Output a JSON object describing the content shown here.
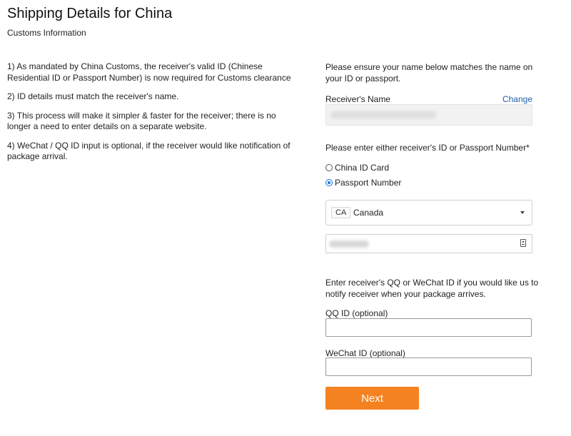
{
  "header": {
    "title": "Shipping Details for China",
    "subtitle": "Customs Information"
  },
  "info": {
    "items": [
      "1) As mandated by China Customs, the receiver's valid ID (Chinese Residential ID or Passport Number) is now required for Customs clearance",
      "2) ID details must match the receiver's name.",
      "3) This process will make it simpler & faster for the receiver; there is no longer a need to enter details on a separate website.",
      "4) WeChat / QQ ID input is optional, if the receiver would like notification of package arrival."
    ]
  },
  "form": {
    "name_note": "Please ensure your name below matches the name on your ID or passport.",
    "name_label": "Receiver's Name",
    "change_label": "Change",
    "id_prompt": "Please enter either receiver's ID or Passport Number*",
    "id_options": [
      {
        "label": "China ID Card",
        "checked": false
      },
      {
        "label": "Passport Number",
        "checked": true
      }
    ],
    "country": {
      "code": "CA",
      "name": "Canada"
    },
    "qq_note": "Enter receiver's QQ or WeChat ID if you would like us to notify receiver when your package arrives.",
    "qq_label": "QQ ID (optional)",
    "wechat_label": "WeChat ID (optional)",
    "next_label": "Next"
  },
  "colors": {
    "accent_button": "#f58220",
    "link": "#1f5fa8"
  }
}
